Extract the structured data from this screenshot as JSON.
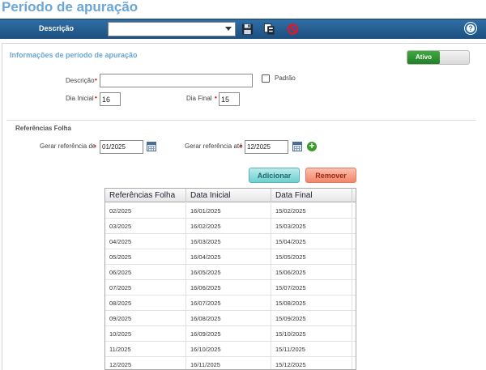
{
  "page": {
    "title": "Período de apuração"
  },
  "toolbar": {
    "label": "Descrição",
    "combo_value": "",
    "help_symbol": "?"
  },
  "section_info": {
    "title": "Informações de período de apuração",
    "status_label": "Ativo"
  },
  "form": {
    "descricao_label": "Descrição",
    "descricao_value": "",
    "padrao_label": "Padrão",
    "dia_inicial_label": "Dia Inicial",
    "dia_inicial_value": "16",
    "dia_final_label": "Dia Final",
    "dia_final_value": "15",
    "required_mark": "•"
  },
  "section_ref": {
    "title": "Referências Folha",
    "gerar_de_label": "Gerar referência de",
    "gerar_de_value": "01/2025",
    "gerar_ate_label": "Gerar referência até",
    "gerar_ate_value": "12/2025"
  },
  "buttons": {
    "add": "Adicionar",
    "remove": "Remover"
  },
  "table": {
    "headers": [
      "Referências Folha",
      "Data Inicial",
      "Data Final"
    ],
    "rows": [
      [
        "02/2025",
        "16/01/2025",
        "15/02/2025"
      ],
      [
        "03/2025",
        "16/02/2025",
        "15/03/2025"
      ],
      [
        "04/2025",
        "16/03/2025",
        "15/04/2025"
      ],
      [
        "05/2025",
        "16/04/2025",
        "15/05/2025"
      ],
      [
        "06/2025",
        "16/05/2025",
        "15/06/2025"
      ],
      [
        "07/2025",
        "16/06/2025",
        "15/07/2025"
      ],
      [
        "08/2025",
        "16/07/2025",
        "15/08/2025"
      ],
      [
        "09/2025",
        "16/08/2025",
        "15/09/2025"
      ],
      [
        "10/2025",
        "16/09/2025",
        "15/10/2025"
      ],
      [
        "11/2025",
        "16/10/2025",
        "15/11/2025"
      ],
      [
        "12/2025",
        "16/11/2025",
        "15/12/2025"
      ]
    ]
  },
  "colors": {
    "title": "#6aa6d6",
    "toolbar": "#1d4f7f",
    "active": "#22802a",
    "required": "#dd0000"
  },
  "icons": [
    "save-icon",
    "copy-icon",
    "cancel-icon",
    "help-icon",
    "calendar-icon",
    "add-icon"
  ]
}
